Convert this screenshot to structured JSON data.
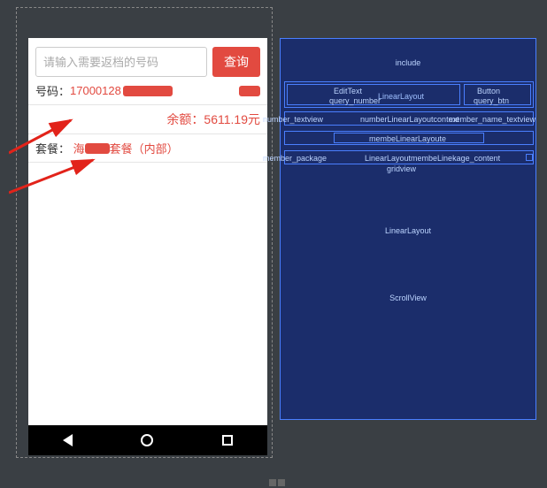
{
  "search": {
    "placeholder": "请输入需要返档的号码",
    "query_label": "查询"
  },
  "info": {
    "number_label": "号码：",
    "number_value": "17000128",
    "balance_label": "余额：",
    "balance_value": "5611.19元",
    "package_label": "套餐：",
    "package_value": "套餐（内部）"
  },
  "wireframe": {
    "include": "include",
    "edittext": "EditText",
    "query_number": "query_number",
    "button": "Button",
    "query_btn": "query_btn",
    "linearlayout": "LinearLayout",
    "number_textview": "number_textview",
    "number_textview_context": "numberLinearLayoutcontext",
    "member_name_textview": "member_name_textview",
    "member_balance": "membeLinearLayoute",
    "member_package": "member_package",
    "member_package_content": "LinearLayoutmembeLinekage_content",
    "gridview": "gridview",
    "scrollview": "ScrollView"
  }
}
